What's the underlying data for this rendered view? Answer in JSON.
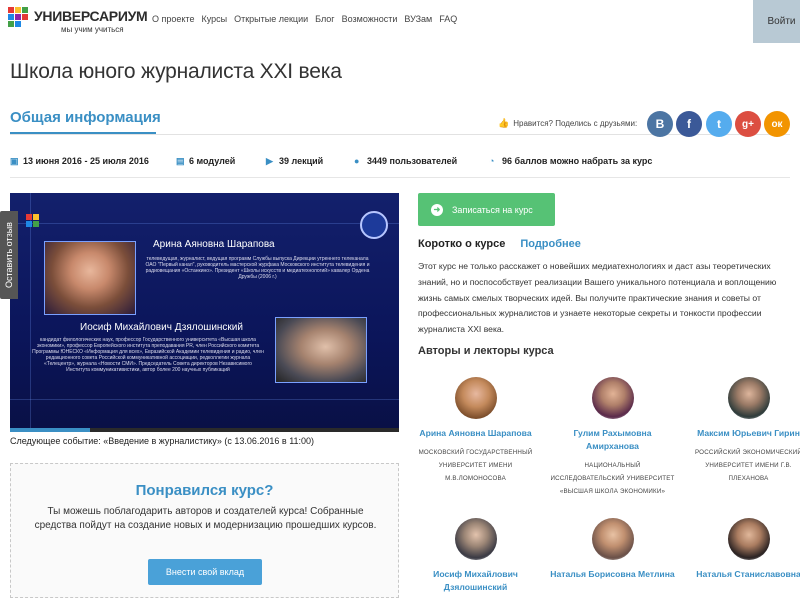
{
  "brand": {
    "name": "УНИВЕРСАРИУМ",
    "tagline": "мы учим учиться"
  },
  "nav": [
    "О проекте",
    "Курсы",
    "Открытые лекции",
    "Блог",
    "Возможности",
    "ВУЗам",
    "FAQ"
  ],
  "login_label": "Войти",
  "course_title": "Школа юного журналиста XXI века",
  "tab_info": "Общая информация",
  "share_label": "Нравится? Поделись с друзьями:",
  "social": [
    {
      "icon": "vk-icon",
      "glyph": "В",
      "color": "#4c75a3"
    },
    {
      "icon": "facebook-icon",
      "glyph": "f",
      "color": "#3b5998"
    },
    {
      "icon": "twitter-icon",
      "glyph": "t",
      "color": "#55acee"
    },
    {
      "icon": "googleplus-icon",
      "glyph": "g+",
      "color": "#dc4e41"
    },
    {
      "icon": "odnoklassniki-icon",
      "glyph": "ок",
      "color": "#f29400"
    }
  ],
  "stats": {
    "dates": "13 июня 2016 - 25 июля 2016",
    "modules": "6 модулей",
    "lectures": "39 лекций",
    "users": "3449 пользователей",
    "points": "96 баллов можно набрать за курс"
  },
  "video": {
    "person1_name": "Арина Аяновна Шарапова",
    "person1_bio": "телеведущая, журналист, ведущая программ Службы выпуска Дирекции утреннего телеканала ОАО \"Первый канал\", руководитель мастерской журфака Московского института телевидения и радиовещания «Останкино». Президент «Школы искусств и медиатехнологий» кавалер Ордена Дружбы (2006 г.)",
    "person2_name": "Иосиф Михайлович Дзялошинский",
    "person2_bio": "кандидат филологических наук, профессор Государственного университета «Высшая школа экономики», профессор Европейского института преподавания PR, член Российского комитета Программы ЮНЕСКО «Информация для всех», Евразийской Академии телевидения и радио, член редакционного совета Российской коммуникативной ассоциации, редколлегии журнала «Телецентр», журнала «Новости СМИ». Председатель Совета директоров Независимого Института коммуникативистики, автор более 200 научных публикаций"
  },
  "next_event": "Следующее событие: «Введение в журналистику» (с 13.06.2016 в 11:00)",
  "feedback_label": "Оставить отзыв",
  "donate": {
    "title": "Понравился курс?",
    "text": "Ты можешь поблагодарить авторов и создателей курса! Собранные средства пойдут на создание новых и модернизацию прошедших курсов.",
    "button": "Внести свой вклад"
  },
  "enroll_label": "Записаться на курс",
  "about": {
    "tab_short": "Коротко о курсе",
    "tab_more": "Подробнее",
    "text": "Этот курс не только расскажет о новейших медиатехнологиях и даст азы теоретических знаний, но и поспособствует реализации Вашего уникального потенциала и воплощению жизнь самых смелых творческих идей. Вы получите практические знания и советы от профессиональных журналистов и узнаете некоторые секреты и тонкости профессии журналиста XXI века."
  },
  "authors_heading": "Авторы и лекторы курса",
  "authors": [
    {
      "name": "Арина Аяновна Шарапова",
      "org": "МОСКОВСКИЙ ГОСУДАРСТВЕННЫЙ УНИВЕРСИТЕТ ИМЕНИ М.В.ЛОМОНОСОВА"
    },
    {
      "name": "Гулим Рахымовна Амирханова",
      "org": "НАЦИОНАЛЬНЫЙ ИССЛЕДОВАТЕЛЬСКИЙ УНИВЕРСИТЕТ «ВЫСШАЯ ШКОЛА ЭКОНОМИКИ»"
    },
    {
      "name": "Максим Юрьевич Гирин",
      "org": "РОССИЙСКИЙ ЭКОНОМИЧЕСКИЙ УНИВЕРСИТЕТ ИМЕНИ Г.В. ПЛЕХАНОВА"
    },
    {
      "name": "Иосиф Михайлович Дзялошинский",
      "org": ""
    },
    {
      "name": "Наталья Борисовна Метлина",
      "org": ""
    },
    {
      "name": "Наталья Станиславовна",
      "org": ""
    }
  ]
}
